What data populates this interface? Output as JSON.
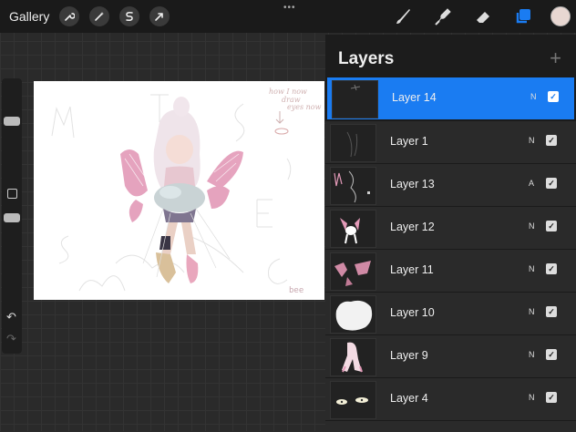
{
  "topbar": {
    "gallery_label": "Gallery",
    "tools": [
      {
        "icon": "wrench-icon",
        "glyph": "🔧"
      },
      {
        "icon": "magic-wand-icon",
        "glyph": "✧"
      },
      {
        "icon": "selection-s-icon",
        "glyph": "S"
      },
      {
        "icon": "transform-arrow-icon",
        "glyph": "➚"
      }
    ],
    "dots": "•••",
    "right_tools": [
      "brush-icon",
      "smudge-icon",
      "eraser-icon",
      "layers-icon"
    ],
    "accent": "#1a7cf2",
    "current_color": "#e8d7d2"
  },
  "sidebar": {
    "undo": "↶",
    "redo": "↷"
  },
  "canvas": {
    "handwriting": [
      "how I now",
      "draw",
      "eyes now"
    ],
    "signature": "bee"
  },
  "layers": {
    "title": "Layers",
    "add": "+",
    "items": [
      {
        "name": "Layer 14",
        "blend": "N",
        "selected": true
      },
      {
        "name": "Layer 1",
        "blend": "N",
        "selected": false
      },
      {
        "name": "Layer 13",
        "blend": "A",
        "selected": false
      },
      {
        "name": "Layer 12",
        "blend": "N",
        "selected": false
      },
      {
        "name": "Layer 11",
        "blend": "N",
        "selected": false
      },
      {
        "name": "Layer 10",
        "blend": "N",
        "selected": false
      },
      {
        "name": "Layer 9",
        "blend": "N",
        "selected": false
      },
      {
        "name": "Layer 4",
        "blend": "N",
        "selected": false
      }
    ]
  }
}
